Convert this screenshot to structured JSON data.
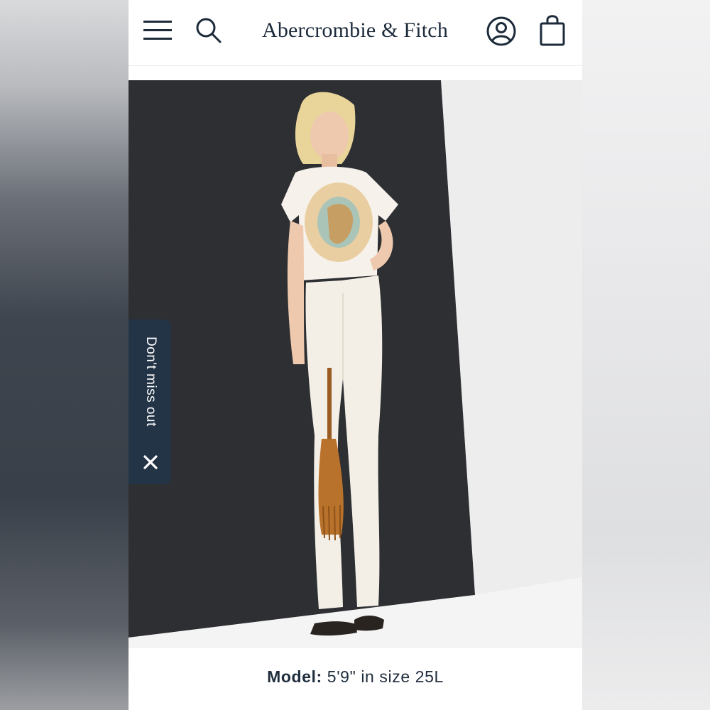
{
  "header": {
    "brand": "Abercrombie & Fitch",
    "icons": [
      "menu-icon",
      "search-icon",
      "account-icon",
      "shopping-bag-icon"
    ]
  },
  "promo_tab": {
    "label": "Don't miss out",
    "close_icon": "close-icon"
  },
  "caption": {
    "label": "Model:",
    "value": "5'9\" in size 25L"
  },
  "colors": {
    "brand_navy": "#1c2a3a",
    "tab_background": "#243447",
    "backdrop_dark": "#2d2f32"
  }
}
